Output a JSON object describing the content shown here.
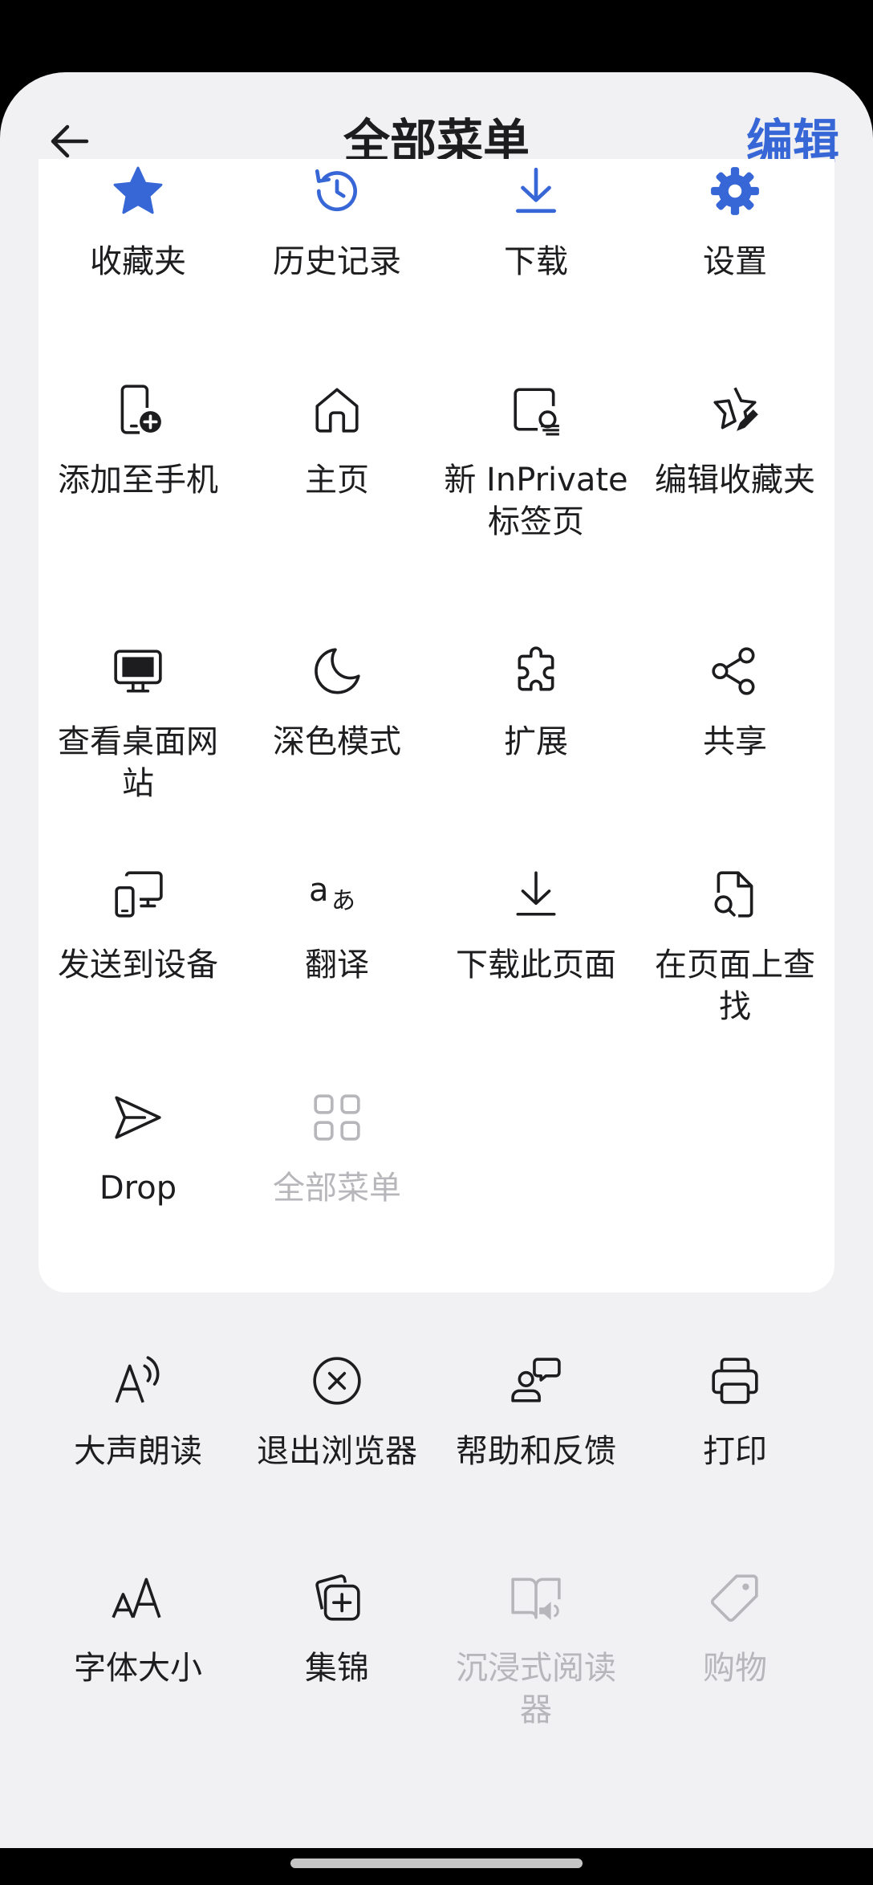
{
  "header": {
    "title": "全部菜单",
    "edit_label": "编辑"
  },
  "colors": {
    "accent": "#3766d6",
    "text": "#1d1d1f",
    "disabled": "#b7b7bb",
    "sheet_bg": "#f1f1f3",
    "card_bg": "#ffffff"
  },
  "menu": {
    "items": [
      {
        "label": "收藏夹",
        "icon": "star-filled-icon"
      },
      {
        "label": "历史记录",
        "icon": "history-icon"
      },
      {
        "label": "下载",
        "icon": "download-icon"
      },
      {
        "label": "设置",
        "icon": "gear-icon"
      },
      {
        "label": "添加至手机",
        "icon": "add-to-phone-icon"
      },
      {
        "label": "主页",
        "icon": "home-icon"
      },
      {
        "label": "新 InPrivate 标签页",
        "icon": "inprivate-tab-icon"
      },
      {
        "label": "编辑收藏夹",
        "icon": "edit-favorites-icon"
      },
      {
        "label": "查看桌面网站",
        "icon": "desktop-site-icon"
      },
      {
        "label": "深色模式",
        "icon": "moon-icon"
      },
      {
        "label": "扩展",
        "icon": "puzzle-icon"
      },
      {
        "label": "共享",
        "icon": "share-icon"
      },
      {
        "label": "发送到设备",
        "icon": "send-to-device-icon"
      },
      {
        "label": "翻译",
        "icon": "translate-icon"
      },
      {
        "label": "下载此页面",
        "icon": "download-page-icon"
      },
      {
        "label": "在页面上查找",
        "icon": "find-on-page-icon"
      },
      {
        "label": "Drop",
        "icon": "drop-send-icon"
      },
      {
        "label": "全部菜单",
        "icon": "grid-icon",
        "disabled": true
      }
    ]
  },
  "more": {
    "items": [
      {
        "label": "大声朗读",
        "icon": "read-aloud-icon"
      },
      {
        "label": "退出浏览器",
        "icon": "exit-icon"
      },
      {
        "label": "帮助和反馈",
        "icon": "help-feedback-icon"
      },
      {
        "label": "打印",
        "icon": "printer-icon"
      },
      {
        "label": "字体大小",
        "icon": "font-size-icon"
      },
      {
        "label": "集锦",
        "icon": "collections-icon"
      },
      {
        "label": "沉浸式阅读器",
        "icon": "immersive-reader-icon",
        "disabled": true
      },
      {
        "label": "购物",
        "icon": "shopping-tag-icon",
        "disabled": true
      }
    ]
  }
}
